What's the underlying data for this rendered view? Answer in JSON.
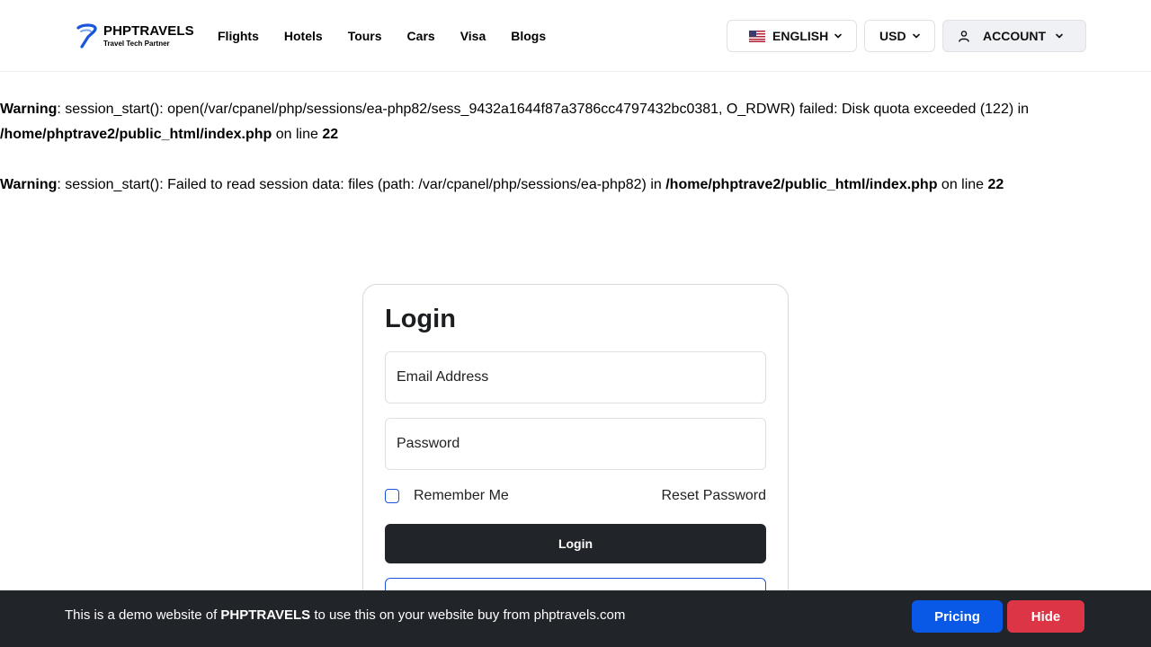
{
  "header": {
    "logo": {
      "name": "PHPTRAVELS",
      "tagline": "Travel Tech Partner"
    },
    "nav": [
      "Flights",
      "Hotels",
      "Tours",
      "Cars",
      "Visa",
      "Blogs"
    ],
    "language": {
      "label": "ENGLISH",
      "flag_icon": "us-flag-icon"
    },
    "currency": {
      "label": "USD"
    },
    "account": {
      "label": "ACCOUNT",
      "icon": "user-icon"
    }
  },
  "warnings": [
    {
      "label": "Warning",
      "message": ": session_start(): open(/var/cpanel/php/sessions/ea-php82/sess_9432a1644f87a3786cc4797432bc0381, O_RDWR) failed: Disk quota exceeded (122) in ",
      "file": "/home/phptrave2/public_html/index.php",
      "line_text": " on line ",
      "line": "22"
    },
    {
      "label": "Warning",
      "message": ": session_start(): Failed to read session data: files (path: /var/cpanel/php/sessions/ea-php82) in ",
      "file": "/home/phptrave2/public_html/index.php",
      "line_text": " on line ",
      "line": "22"
    }
  ],
  "login": {
    "title": "Login",
    "email_placeholder": "Email Address",
    "password_placeholder": "Password",
    "remember_label": "Remember Me",
    "reset_label": "Reset Password",
    "submit_label": "Login"
  },
  "banner": {
    "text_before": "This is a demo website of ",
    "brand": "PHPTRAVELS",
    "text_after": " to use this on your website buy from phptravels.com",
    "pricing_label": "Pricing",
    "hide_label": "Hide"
  },
  "colors": {
    "primary_blue": "#0a58e6",
    "dark": "#212428",
    "danger": "#dc3545"
  }
}
